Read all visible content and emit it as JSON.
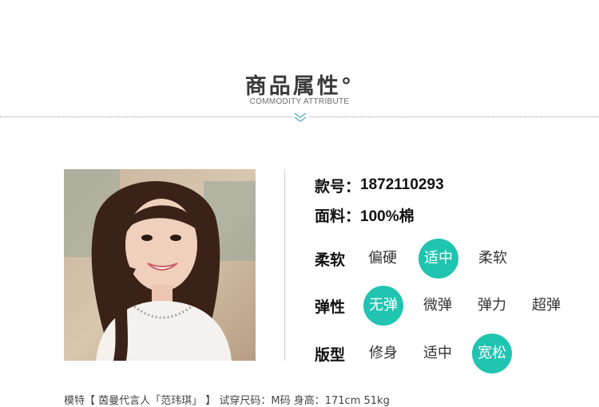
{
  "header": {
    "title": "商品属性°",
    "subtitle": "COMMODITY ATTRIBUTE"
  },
  "details": {
    "style_no_label": "款号：",
    "style_no_value": "1872110293",
    "material_label": "面料：",
    "material_value": "100%棉"
  },
  "attributes": [
    {
      "label": "柔软",
      "options": [
        "偏硬",
        "适中",
        "柔软"
      ],
      "selected_index": 1
    },
    {
      "label": "弹性",
      "options": [
        "无弹",
        "微弹",
        "弹力",
        "超弹"
      ],
      "selected_index": 0
    },
    {
      "label": "版型",
      "options": [
        "修身",
        "适中",
        "宽松"
      ],
      "selected_index": 2
    }
  ],
  "footer": {
    "text": "模特【 茵曼代言人「范玮琪」 】 试穿尺码：M码  身高：171cm 51kg"
  },
  "colors": {
    "accent": "#20c4b0",
    "chevron": "#5fb8c4"
  },
  "icons": {
    "divider": "chevron-down-icon"
  }
}
